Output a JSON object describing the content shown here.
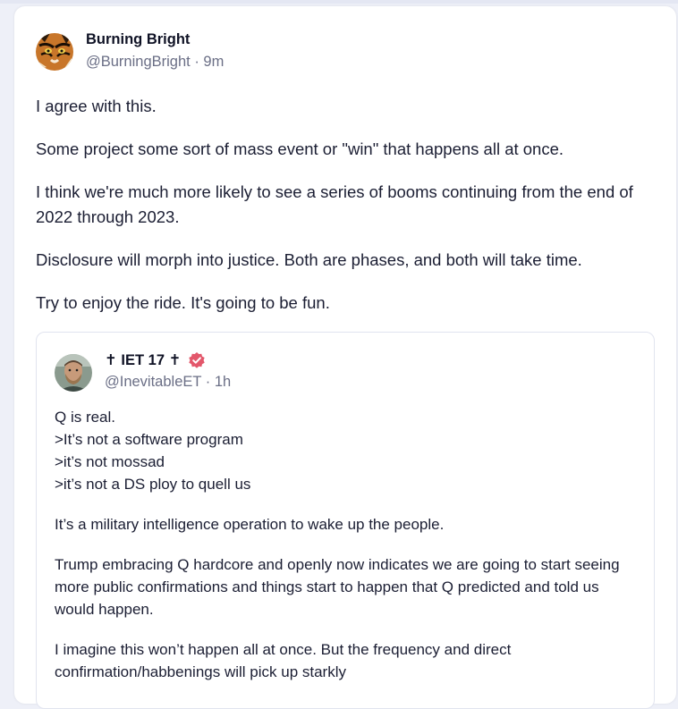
{
  "post": {
    "author_name": "Burning Bright",
    "author_handle": "@BurningBright",
    "separator": "·",
    "timestamp": "9m",
    "avatar_icon": "tiger-avatar",
    "paragraphs": [
      "I agree with this.",
      "Some project some sort of mass event or \"win\" that happens all at once.",
      "I think we're much more likely to see a series of booms continuing from the end of 2022 through 2023.",
      "Disclosure will morph into justice. Both are phases, and both will take time.",
      "Try to enjoy the ride. It's going to be fun."
    ]
  },
  "quoted_post": {
    "author_name": "✝ IET 17 ✝",
    "author_handle": "@InevitableET",
    "separator": "·",
    "timestamp": "1h",
    "verified_icon": "verified-badge-icon",
    "verified_color": "#e3576b",
    "lines_block_1": [
      "Q is real.",
      ">It’s not a software program",
      ">it’s not mossad",
      ">it’s not a DS ploy to quell us"
    ],
    "paragraphs": [
      "It’s a military intelligence operation to wake up the people.",
      "Trump embracing Q hardcore and openly now indicates we are going to start seeing more public confirmations and things start to happen that Q predicted and told us would happen.",
      "I imagine this won’t happen all at once. But the frequency and direct confirmation/habbenings will pick up starkly"
    ]
  },
  "colors": {
    "background": "#eef0f8",
    "card": "#ffffff",
    "text": "#1b1e33",
    "muted": "#6b6f86"
  }
}
